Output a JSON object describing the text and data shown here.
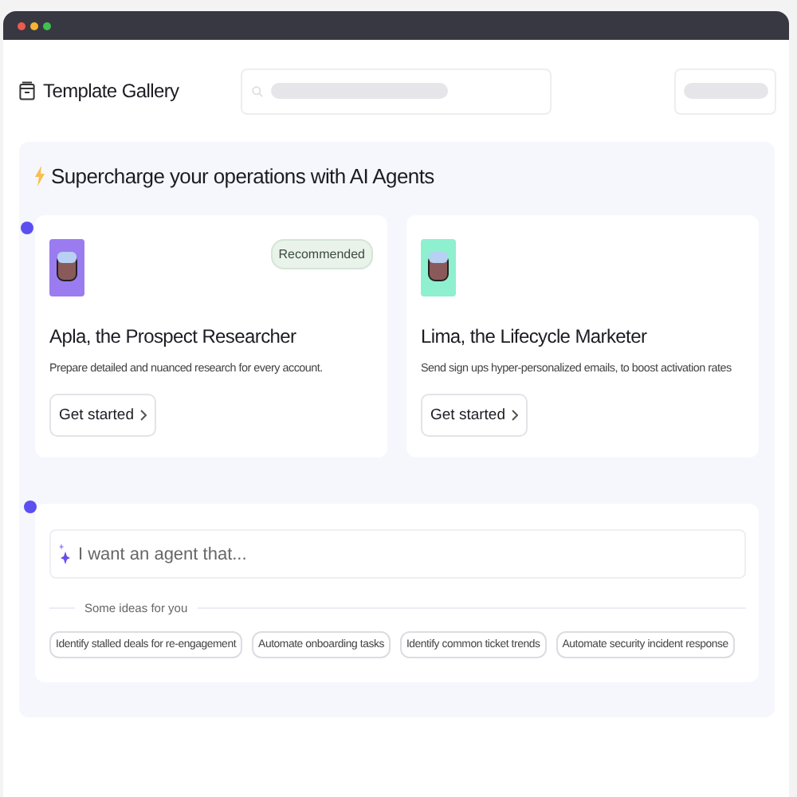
{
  "header": {
    "title": "Template Gallery"
  },
  "agents_panel": {
    "title": "Supercharge your operations with AI Agents",
    "agents": [
      {
        "name": "Apla, the Prospect Researcher",
        "description": "Prepare detailed and nuanced research for every account.",
        "badge": "Recommended",
        "button": "Get started",
        "color": "#9b7cf0"
      },
      {
        "name": "Lima, the Lifecycle Marketer",
        "description": "Send sign ups hyper-personalized emails, to boost activation rates",
        "button": "Get started",
        "color": "#8ef0cf"
      }
    ],
    "prompt": {
      "placeholder": "I want an agent that...",
      "ideas_label": "Some ideas for you",
      "ideas": [
        "Identify stalled deals for re-engagement",
        "Automate onboarding tasks",
        "Identify common ticket trends",
        "Automate security incident response"
      ]
    }
  }
}
